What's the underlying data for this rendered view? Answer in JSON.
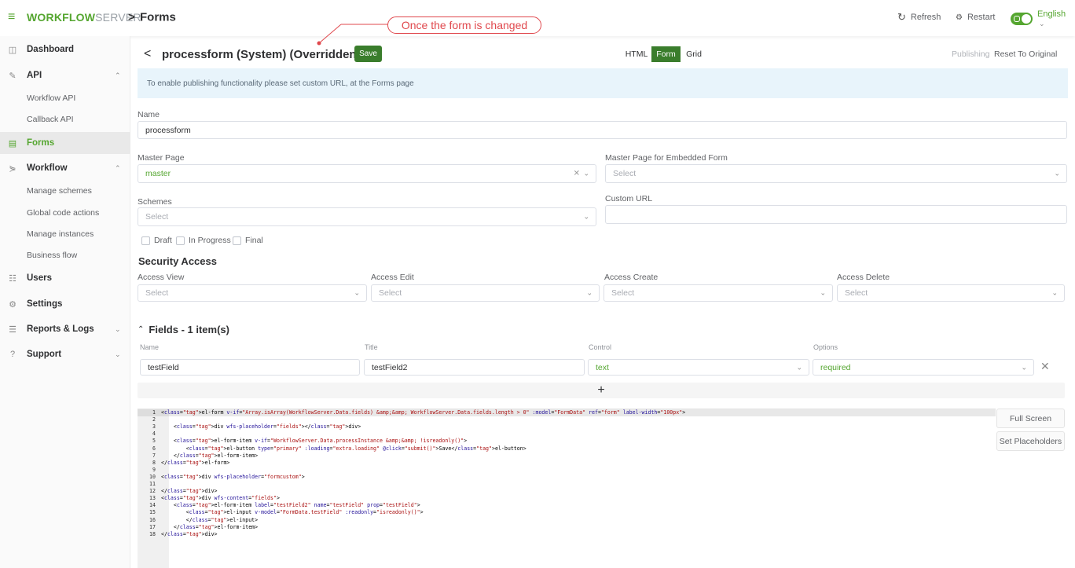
{
  "topbar": {
    "logo_brand": "WORKFLOW",
    "logo_suffix": "SERVER",
    "separator": ">",
    "page": "Forms",
    "callout": "Once the form is changed",
    "refresh": "Refresh",
    "restart": "Restart",
    "language": "English"
  },
  "sidebar": {
    "dashboard": "Dashboard",
    "api": "API",
    "api_children": [
      "Workflow API",
      "Callback API"
    ],
    "forms": "Forms",
    "workflow": "Workflow",
    "workflow_children": [
      "Manage schemes",
      "Global code actions",
      "Manage instances",
      "Business flow"
    ],
    "users": "Users",
    "settings": "Settings",
    "reports": "Reports & Logs",
    "support": "Support"
  },
  "header": {
    "back": "<",
    "title": "processform (System) (Overridden)",
    "save": "Save",
    "views": [
      "HTML",
      "Form",
      "Grid"
    ],
    "active_view": "Form",
    "publishing": "Publishing",
    "reset": "Reset To Original"
  },
  "alert": "To enable publishing functionality please set custom URL, at the Forms page",
  "form": {
    "name_label": "Name",
    "name_value": "processform",
    "master_label": "Master Page",
    "master_value": "master",
    "master_embedded_label": "Master Page for Embedded Form",
    "master_embedded_placeholder": "Select",
    "schemes_label": "Schemes",
    "schemes_placeholder": "Select",
    "custom_url_label": "Custom URL",
    "custom_url_value": "",
    "statuses": [
      "Draft",
      "In Progress",
      "Final"
    ]
  },
  "security": {
    "title": "Security Access",
    "view_label": "Access View",
    "edit_label": "Access Edit",
    "create_label": "Access Create",
    "delete_label": "Access Delete",
    "placeholder": "Select"
  },
  "fields": {
    "title": "Fields - 1 item(s)",
    "headers": [
      "Name",
      "Title",
      "Control",
      "Options"
    ],
    "row": {
      "name": "testField",
      "title": "testField2",
      "control": "text",
      "options": "required"
    },
    "add": "+"
  },
  "editor": {
    "lines": [
      "<el-form v-if=\"Array.isArray(WorkflowServer.Data.fields) &amp;&amp; WorkflowServer.Data.fields.length > 0\" :model=\"FormData\" ref=\"form\" label-width=\"100px\">",
      "",
      "    <div wfs-placeholder=\"fields\"></div>",
      "",
      "    <el-form-item v-if=\"WorkflowServer.Data.processInstance &amp;&amp; !isreadonly()\">",
      "        <el-button type=\"primary\" :loading=\"extra.loading\" @click=\"submit()\">Save</el-button>",
      "    </el-form-item>",
      "</el-form>",
      "",
      "<div wfs-placeholder=\"formcustom\">",
      "",
      "</div>",
      "<div wfs-content=\"fields\">",
      "    <el-form-item label=\"testField2\" name=\"testField\" prop=\"testField\">",
      "        <el-input v-model=\"FormData.testField\" :readonly=\"isreadonly()\">",
      "        </el-input>",
      "    </el-form-item>",
      "</div>"
    ],
    "full_screen": "Full Screen",
    "set_placeholders": "Set Placeholders"
  },
  "colors": {
    "brand": "#55a630",
    "save": "#3a7d2c",
    "callout": "#e0484d",
    "alert_bg": "#e8f4fb"
  },
  "icons": [
    "menu-icon",
    "refresh-icon",
    "restart-icon",
    "toggle-icon",
    "chevron-down-icon",
    "dashboard-icon",
    "api-icon",
    "forms-icon",
    "workflow-icon",
    "users-icon",
    "settings-icon",
    "reports-icon",
    "support-icon",
    "close-icon",
    "plus-icon"
  ]
}
